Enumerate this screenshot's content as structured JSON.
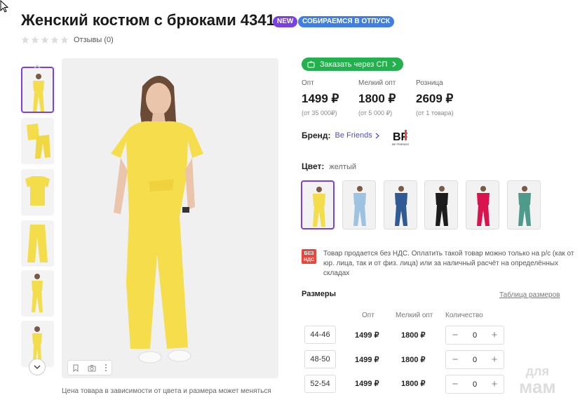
{
  "product": {
    "title": "Женский костюм с брюками 4341",
    "badges": {
      "new": "NEW",
      "vacation": "СОБИРАЕМСЯ В ОТПУСК"
    },
    "reviews": "Отзывы (0)",
    "rating_stars": 0,
    "caption": "Цена товара в зависимости от цвета и размера может меняться"
  },
  "order_button": "Заказать через СП",
  "prices": [
    {
      "label": "Опт",
      "value": "1499 ₽",
      "note": "(от 35 000₽)"
    },
    {
      "label": "Мелкий опт",
      "value": "1800 ₽",
      "note": "(от 5 000 ₽)"
    },
    {
      "label": "Розница",
      "value": "2609 ₽",
      "note": "(от 1 товара)"
    }
  ],
  "brand": {
    "label": "Бренд:",
    "name": "Be Friends",
    "logo_text": "BF",
    "logo_sub": "BE FRIENDS"
  },
  "color": {
    "label": "Цвет:",
    "value": "желтый",
    "swatches": [
      "#f3dd4a",
      "#9ec3e0",
      "#2f5a93",
      "#1c1c1c",
      "#d8134e",
      "#4e9b8c"
    ]
  },
  "nds": {
    "icon": [
      "БЕЗ",
      "НДС"
    ],
    "text": "Товар продается без НДС. Оплатить такой товар можно только на р/с (как от юр. лица, так и от физ. лица) или за наличный расчёт на определённых складах"
  },
  "sizes": {
    "title": "Размеры",
    "table_link": "Таблица размеров",
    "headers": {
      "opt": "Опт",
      "small_opt": "Мелкий опт",
      "qty": "Количество"
    },
    "rows": [
      {
        "size": "44-46",
        "opt": "1499 ₽",
        "small_opt": "1800 ₽",
        "qty": "0"
      },
      {
        "size": "48-50",
        "opt": "1499 ₽",
        "small_opt": "1800 ₽",
        "qty": "0"
      },
      {
        "size": "52-54",
        "opt": "1499 ₽",
        "small_opt": "1800 ₽",
        "qty": "0"
      }
    ]
  },
  "watermark": {
    "line1": "для",
    "line2": "мам"
  }
}
